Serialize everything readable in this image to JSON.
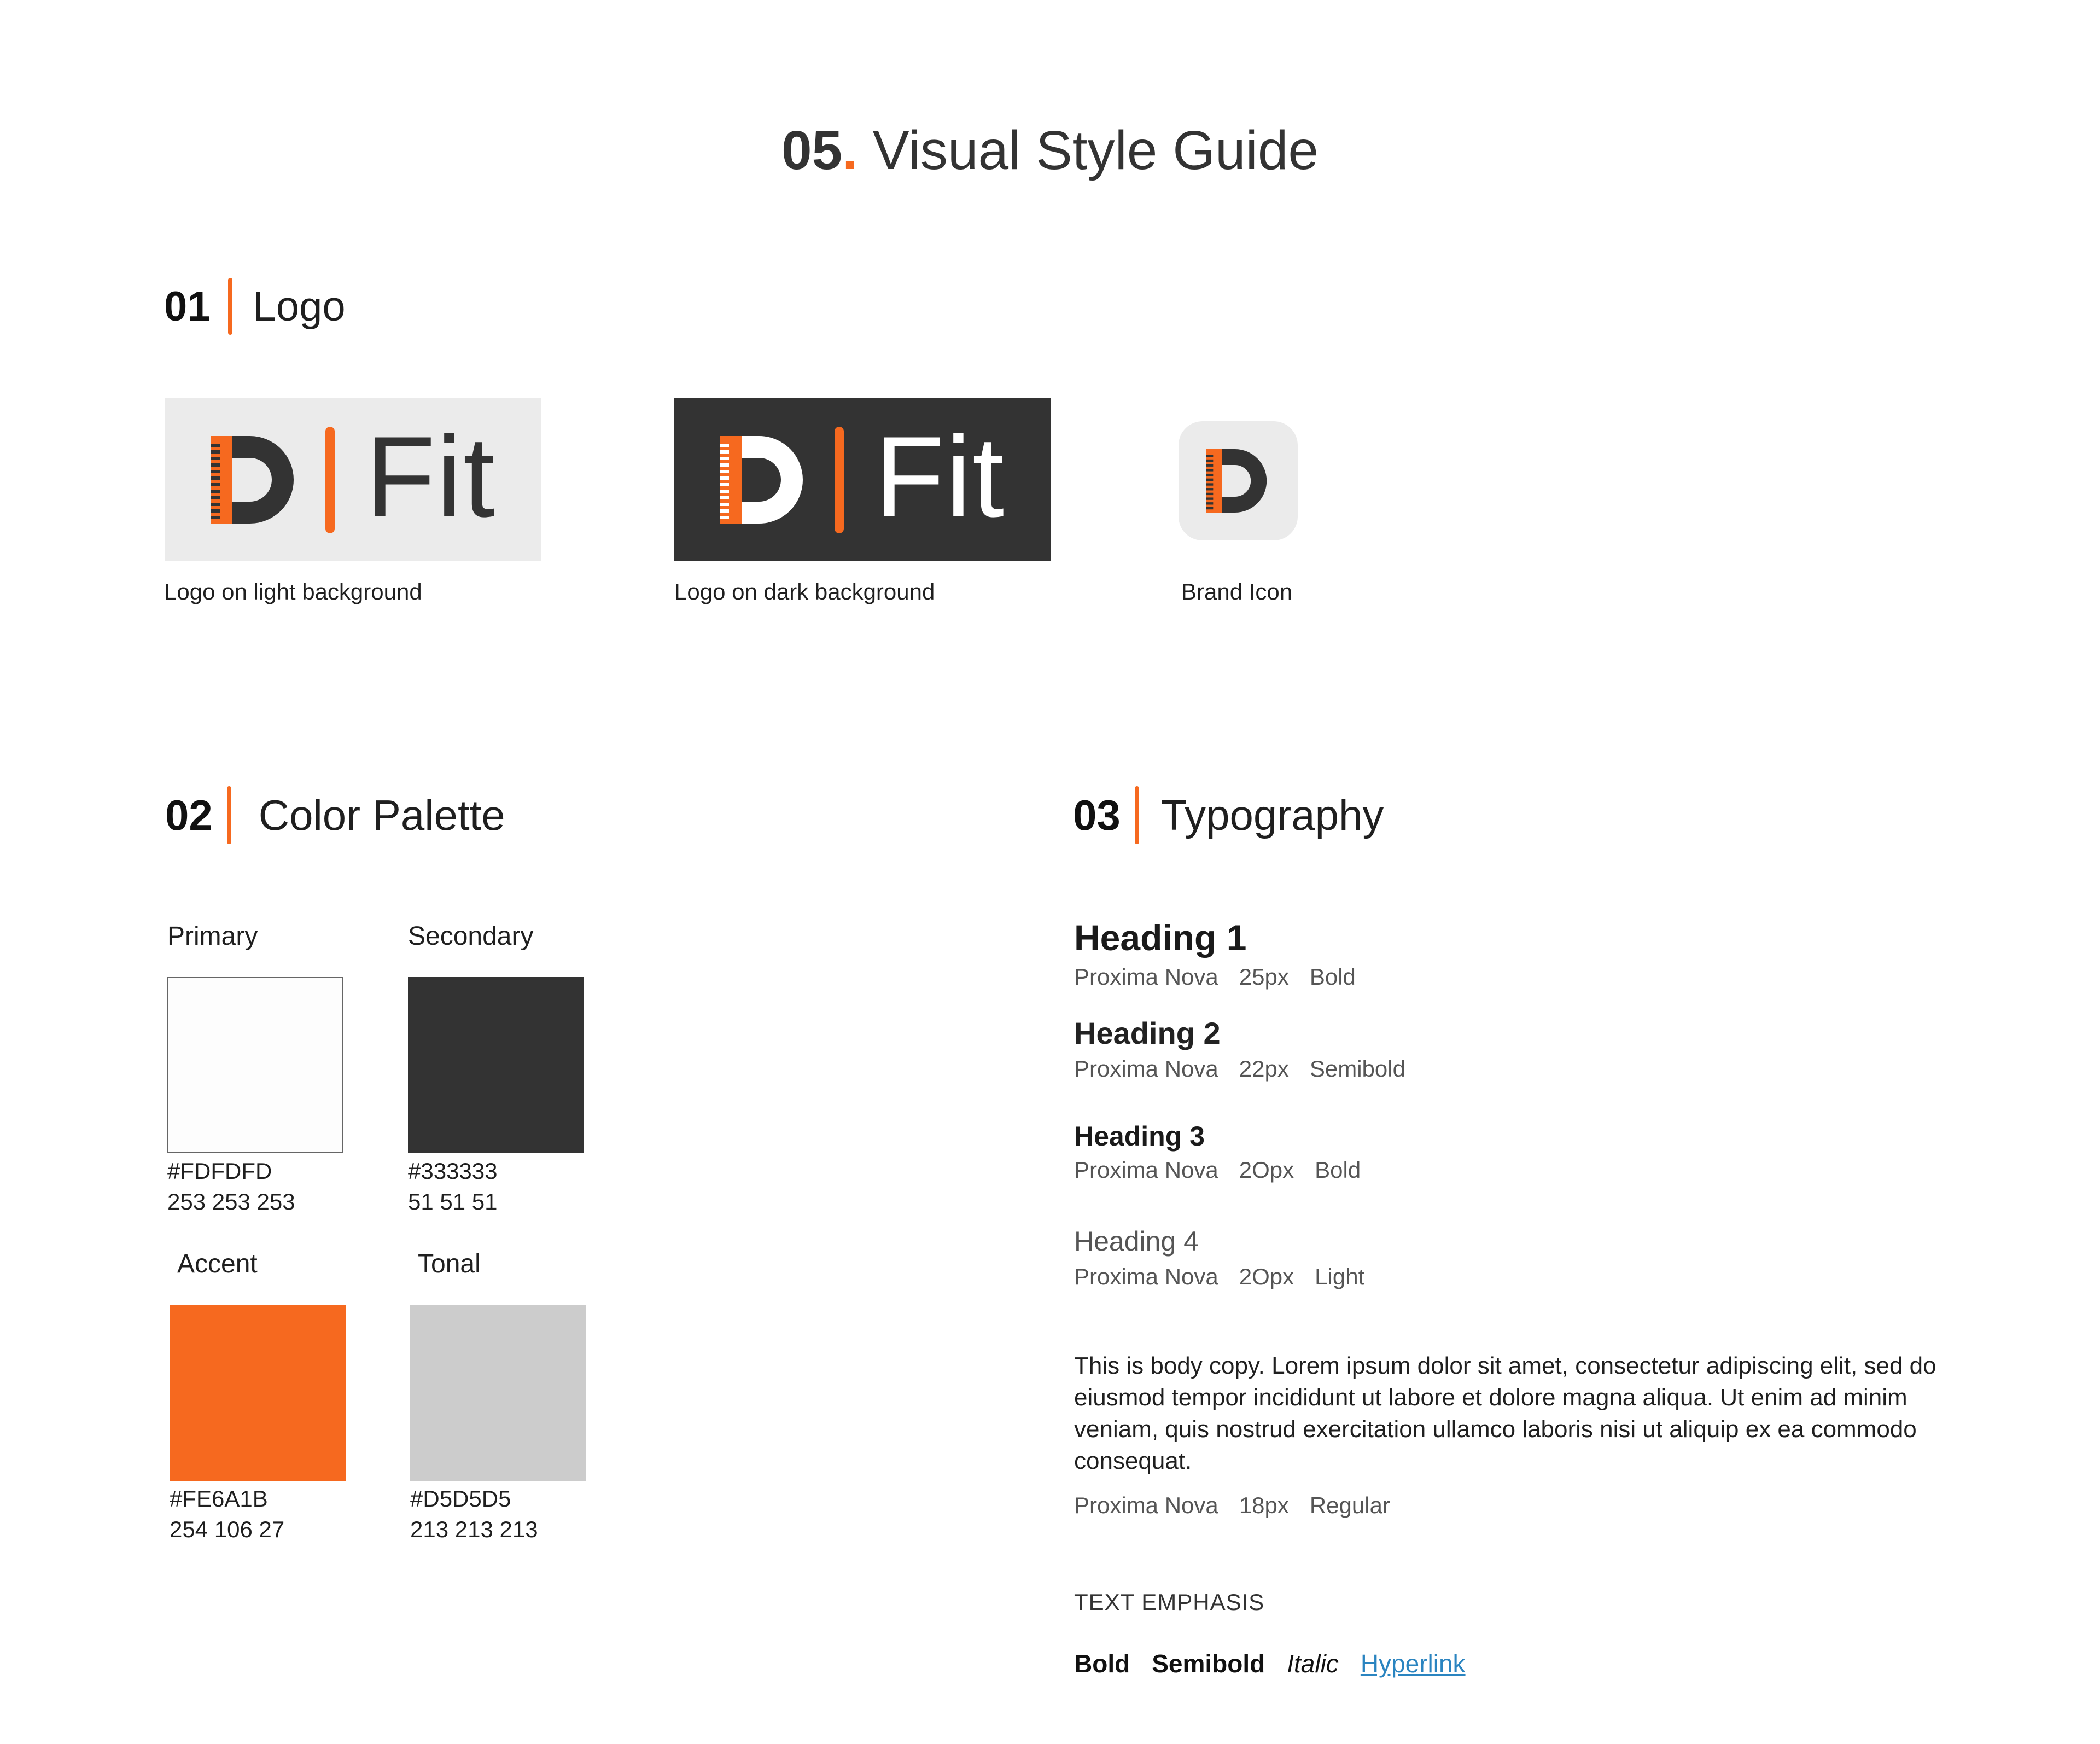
{
  "title": {
    "number": "05",
    "dot": ".",
    "text": "Visual Style Guide"
  },
  "colors": {
    "accent": "#F6691F",
    "dark": "#333333",
    "light_bg": "#EBEBEB",
    "icon_bg": "#EBEBEB",
    "link": "#2A84C0"
  },
  "logo_section": {
    "number": "01",
    "title": "Logo",
    "wordmark": "Fit",
    "captions": {
      "light": "Logo on light background",
      "dark": "Logo on dark background",
      "icon": "Brand Icon"
    }
  },
  "palette_section": {
    "number": "02",
    "title": "Color Palette",
    "swatches": [
      {
        "label": "Primary",
        "fill": "#FDFDFD",
        "hex": "#FDFDFD",
        "rgb": "253 253 253"
      },
      {
        "label": "Secondary",
        "fill": "#333333",
        "hex": "#333333",
        "rgb": "51 51 51"
      },
      {
        "label": "Accent",
        "fill": "#F6691F",
        "hex": "#FE6A1B",
        "rgb": "254 106 27"
      },
      {
        "label": "Tonal",
        "fill": "#CCCCCC",
        "hex": "#D5D5D5",
        "rgb": "213 213 213"
      }
    ]
  },
  "typography_section": {
    "number": "03",
    "title": "Typography",
    "headings": [
      {
        "label": "Heading 1",
        "font": "Proxima Nova",
        "size": "25px",
        "weight": "Bold"
      },
      {
        "label": "Heading 2",
        "font": "Proxima Nova",
        "size": "22px",
        "weight": "Semibold"
      },
      {
        "label": "Heading 3",
        "font": "Proxima Nova",
        "size": "2Opx",
        "weight": "Bold"
      },
      {
        "label": "Heading 4",
        "font": "Proxima Nova",
        "size": "2Opx",
        "weight": "Light"
      }
    ],
    "body": {
      "text": "This is body copy. Lorem ipsum dolor sit amet, consectetur adipiscing elit, sed do eiusmod tempor incididunt ut labore et dolore magna aliqua. Ut enim ad minim veniam, quis nostrud exercitation ullamco laboris nisi ut aliquip ex ea commodo consequat.",
      "font": "Proxima Nova",
      "size": "18px",
      "weight": "Regular"
    },
    "emphasis": {
      "label": "TEXT EMPHASIS",
      "bold": "Bold",
      "semibold": "Semibold",
      "italic": "Italic",
      "hyperlink": "Hyperlink"
    }
  }
}
